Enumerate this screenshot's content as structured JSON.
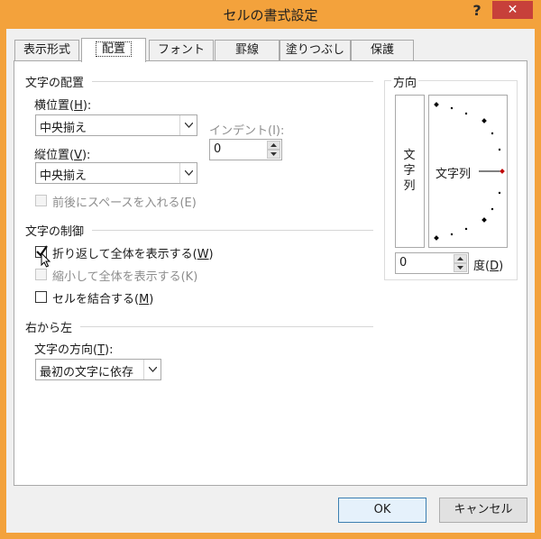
{
  "window": {
    "title": "セルの書式設定",
    "help_label": "?",
    "close_label": "✕"
  },
  "tabs": [
    {
      "label": "表示形式"
    },
    {
      "label": "配置",
      "active": true
    },
    {
      "label": "フォント"
    },
    {
      "label": "罫線"
    },
    {
      "label": "塗りつぶし"
    },
    {
      "label": "保護"
    }
  ],
  "text_alignment": {
    "group_title": "文字の配置",
    "horizontal_label": "横位置(",
    "horizontal_key": "H",
    "horizontal_value": "中央揃え",
    "vertical_label": "縦位置(",
    "vertical_key": "V",
    "vertical_value": "中央揃え",
    "indent_label": "インデント(I):",
    "indent_value": "0",
    "distributed_label": "前後にスペースを入れる(E)"
  },
  "text_control": {
    "group_title": "文字の制御",
    "wrap_label": "折り返して全体を表示する(",
    "wrap_key": "W",
    "wrap_checked": true,
    "shrink_label": "縮小して全体を表示する(K)",
    "shrink_checked": false,
    "merge_label": "セルを結合する(",
    "merge_key": "M",
    "merge_checked": false
  },
  "rtl": {
    "group_title": "右から左",
    "direction_label": "文字の方向(",
    "direction_key": "T",
    "direction_value": "最初の文字に依存"
  },
  "orientation": {
    "group_title": "方向",
    "vertical_chars": [
      "文",
      "字",
      "列"
    ],
    "dial_label": "文字列",
    "degree_value": "0",
    "degree_label": "度(",
    "degree_key": "D"
  },
  "footer": {
    "ok_label": "OK",
    "cancel_label": "キャンセル"
  },
  "colors": {
    "frame": "#f3a23c",
    "close": "#c7403a",
    "dial_marker": "#c00000"
  }
}
